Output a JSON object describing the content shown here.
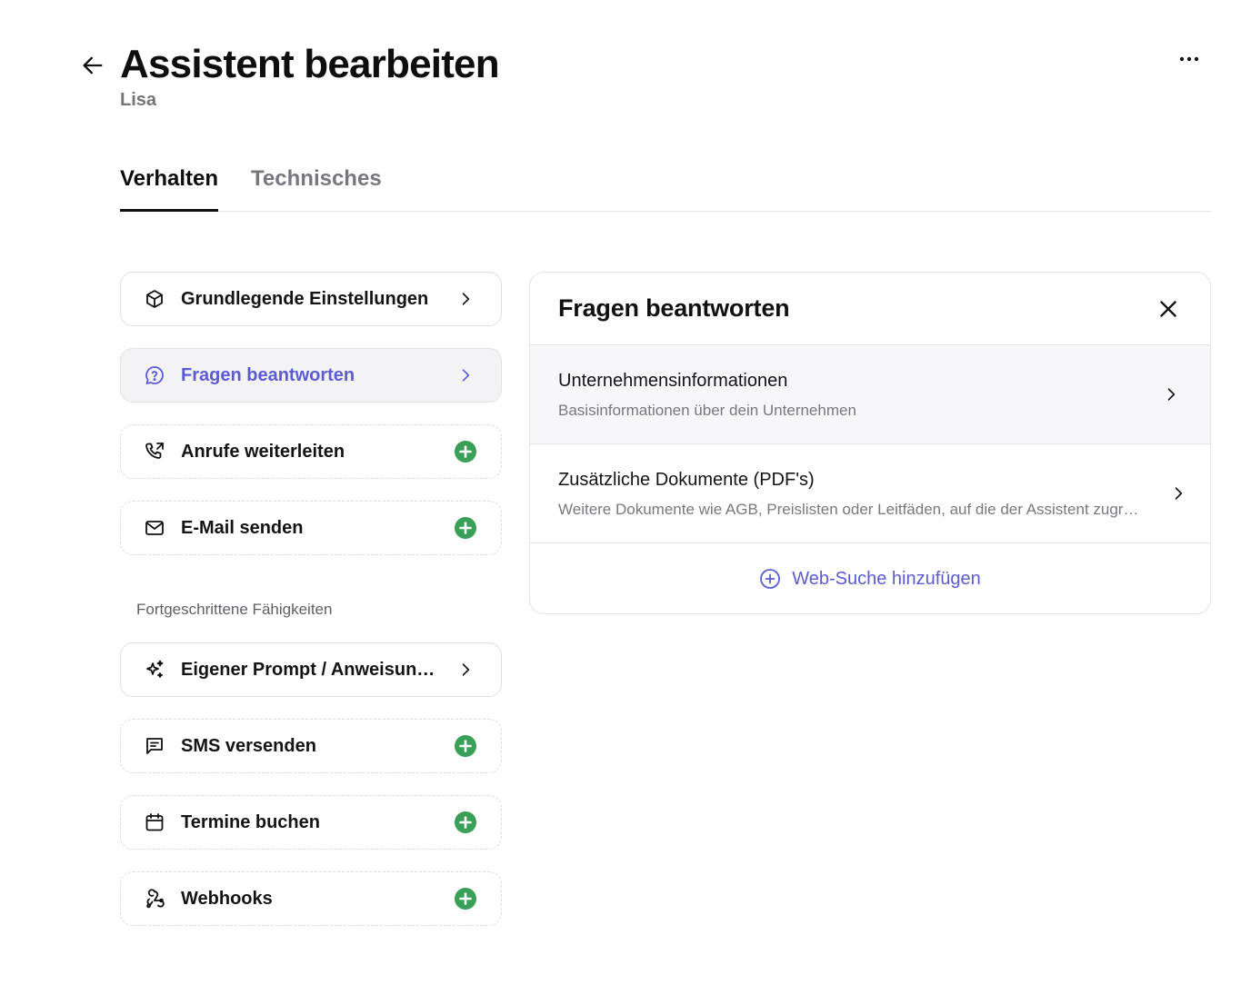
{
  "header": {
    "title": "Assistent bearbeiten",
    "subtitle": "Lisa",
    "back_icon": "arrow-left-icon",
    "more_icon": "more-horizontal-icon"
  },
  "tabs": [
    {
      "label": "Verhalten",
      "active": true
    },
    {
      "label": "Technisches",
      "active": false
    }
  ],
  "capabilities": [
    {
      "label": "Grundlegende Einstellungen",
      "icon": "box-icon",
      "action": "chevron",
      "state": "configured"
    },
    {
      "label": "Fragen beantworten",
      "icon": "message-question-icon",
      "action": "chevron",
      "state": "selected"
    },
    {
      "label": "Anrufe weiterleiten",
      "icon": "phone-forward-icon",
      "action": "add",
      "state": "available"
    },
    {
      "label": "E-Mail senden",
      "icon": "mail-icon",
      "action": "add",
      "state": "available"
    }
  ],
  "advanced_section": {
    "label": "Fortgeschrittene Fähigkeiten",
    "items": [
      {
        "label": "Eigener Prompt / Anweisungen",
        "icon": "sparkles-icon",
        "action": "chevron",
        "state": "configured"
      },
      {
        "label": "SMS versenden",
        "icon": "message-text-icon",
        "action": "add",
        "state": "available"
      },
      {
        "label": "Termine buchen",
        "icon": "calendar-icon",
        "action": "add",
        "state": "available"
      },
      {
        "label": "Webhooks",
        "icon": "webhook-icon",
        "action": "add",
        "state": "available"
      }
    ]
  },
  "panel": {
    "title": "Fragen beantworten",
    "close_icon": "close-icon",
    "rows": [
      {
        "title": "Unternehmensinformationen",
        "description": "Basisinformationen über dein Unternehmen"
      },
      {
        "title": "Zusätzliche Dokumente (PDF's)",
        "description": "Weitere Dokumente wie AGB, Preislisten oder Leitfäden, auf die der Assistent zugreifen kann"
      }
    ],
    "add_label": "Web-Suche hinzufügen",
    "add_icon": "plus-circle-icon"
  },
  "colors": {
    "accent": "#5b5bd6",
    "add_green": "#3aa057",
    "text": "#111111",
    "muted": "#77787d"
  }
}
